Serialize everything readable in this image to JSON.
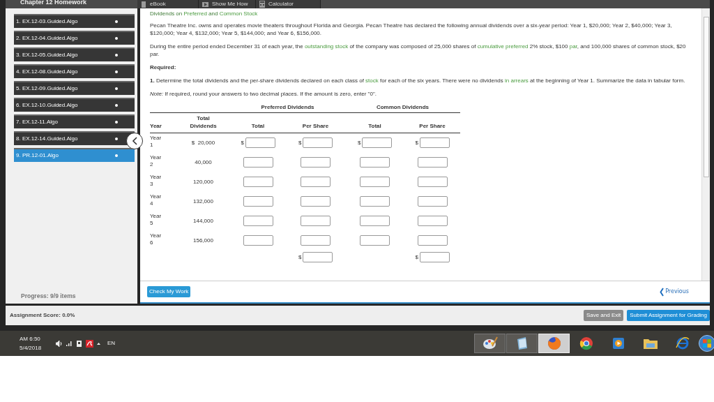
{
  "header": {
    "title": "Chapter 12 Homework",
    "tabs": [
      {
        "label": "eBook",
        "kind": "book"
      },
      {
        "label": "Show Me How",
        "kind": "video"
      },
      {
        "label": "Calculator",
        "kind": "calculator"
      }
    ]
  },
  "sidebar": {
    "items": [
      {
        "label": "1. EX.12-03.Guided.Algo",
        "selected": false
      },
      {
        "label": "2. EX.12-04.Guided.Algo",
        "selected": false
      },
      {
        "label": "3. EX.12-05.Guided.Algo",
        "selected": false
      },
      {
        "label": "4. EX.12-08.Guided.Algo",
        "selected": false
      },
      {
        "label": "5. EX.12-09.Guided.Algo",
        "selected": false
      },
      {
        "label": "6. EX.12-10.Guided.Algo",
        "selected": false
      },
      {
        "label": "7. EX.12-11.Algo",
        "selected": false
      },
      {
        "label": "8. EX.12-14.Guided.Algo",
        "selected": false
      },
      {
        "label": "9. PR.12-01.Algo",
        "selected": true
      }
    ],
    "progress": "Progress: 9/9 items"
  },
  "problem": {
    "title": [
      {
        "text": "Dividends on ",
        "link": false
      },
      {
        "text": "Preferred",
        "link": true
      },
      {
        "text": " and ",
        "link": false
      },
      {
        "text": "Common Stock",
        "link": true
      }
    ],
    "paragraphs": [
      [
        {
          "text": "Pecan Theatre Inc. owns and operates movie theaters throughout Florida and Georgia. Pecan Theatre has declared the following annual dividends over a six-year period: Year 1, $20,000; Year 2, $40,000; Year 3, $120,000; Year 4, $132,000; Year 5, $144,000; and Year 6, $156,000.",
          "link": false
        }
      ],
      [
        {
          "text": "During the entire period ended December 31 of each year, the ",
          "link": false
        },
        {
          "text": "outstanding stock",
          "link": true
        },
        {
          "text": " of the company was composed of 25,000 shares of ",
          "link": false
        },
        {
          "text": "cumulative preferred",
          "link": true
        },
        {
          "text": " 2% stock, $100 ",
          "link": false
        },
        {
          "text": "par",
          "link": true
        },
        {
          "text": ", and 100,000 shares of common stock, $20 par.",
          "link": false
        }
      ],
      [
        {
          "text": "**Required:**",
          "link": false
        }
      ],
      [
        {
          "text": "**1.** Determine the total dividends and the per-share dividends declared on each class of ",
          "link": false
        },
        {
          "text": "stock",
          "link": true
        },
        {
          "text": " for each of the six years. There were no dividends ",
          "link": false
        },
        {
          "text": "in arrears",
          "link": true
        },
        {
          "text": " at the beginning of Year 1. Summarize the data in tabular form.",
          "link": false
        }
      ],
      [
        {
          "text": "*Note:* If required, round your answers to two decimal places. If the amount is zero, enter \"0\".",
          "link": false
        }
      ]
    ],
    "table": {
      "groups": [
        "Preferred Dividends",
        "Common Dividends"
      ],
      "columns": [
        "Year",
        "Total Dividends",
        "Total",
        "Per Share",
        "Total",
        "Per Share"
      ],
      "rows": [
        {
          "year": "Year 1",
          "prefix": "$",
          "dividends": "20,000",
          "fields": [
            {
              "kind": "currency",
              "prefix": "$"
            },
            {
              "kind": "currency",
              "prefix": "$"
            },
            {
              "kind": "currency",
              "prefix": "$"
            },
            {
              "kind": "currency",
              "prefix": "$"
            }
          ]
        },
        {
          "year": "Year 2",
          "dividends": "40,000",
          "fields": [
            {
              "kind": "plain"
            },
            {
              "kind": "plain"
            },
            {
              "kind": "plain"
            },
            {
              "kind": "plain"
            }
          ]
        },
        {
          "year": "Year 3",
          "dividends": "120,000",
          "fields": [
            {
              "kind": "plain"
            },
            {
              "kind": "plain"
            },
            {
              "kind": "plain"
            },
            {
              "kind": "plain"
            }
          ]
        },
        {
          "year": "Year 4",
          "dividends": "132,000",
          "fields": [
            {
              "kind": "plain"
            },
            {
              "kind": "plain"
            },
            {
              "kind": "plain"
            },
            {
              "kind": "plain"
            }
          ]
        },
        {
          "year": "Year 5",
          "dividends": "144,000",
          "fields": [
            {
              "kind": "plain"
            },
            {
              "kind": "plain"
            },
            {
              "kind": "plain"
            },
            {
              "kind": "plain"
            }
          ]
        },
        {
          "year": "Year 6",
          "dividends": "156,000",
          "fields": [
            {
              "kind": "plain"
            },
            {
              "kind": "plain"
            },
            {
              "kind": "plain"
            },
            {
              "kind": "plain"
            }
          ]
        }
      ],
      "totals": [
        {
          "kind": "none"
        },
        {
          "kind": "currency",
          "prefix": "$"
        },
        {
          "kind": "none"
        },
        {
          "kind": "currency",
          "prefix": "$"
        }
      ]
    }
  },
  "footer": {
    "check_button": "Check My Work",
    "previous": "Previous"
  },
  "bottom_bar": {
    "score": "Assignment Score: 0.0%",
    "buttons": [
      {
        "label": "Save and Exit",
        "kind": "secondary"
      },
      {
        "label": "Submit Assignment for Grading",
        "kind": "primary"
      }
    ]
  },
  "taskbar": {
    "time": "AM 6:50",
    "date": "5/4/2018",
    "language": "EN",
    "apps": [
      {
        "kind": "paint",
        "selected": false
      },
      {
        "kind": "notepad",
        "selected": false
      },
      {
        "kind": "firefox",
        "selected": true
      },
      {
        "kind": "chrome",
        "selected": false
      },
      {
        "kind": "player",
        "selected": false
      },
      {
        "kind": "folder",
        "selected": false
      },
      {
        "kind": "ie",
        "selected": false
      }
    ]
  }
}
